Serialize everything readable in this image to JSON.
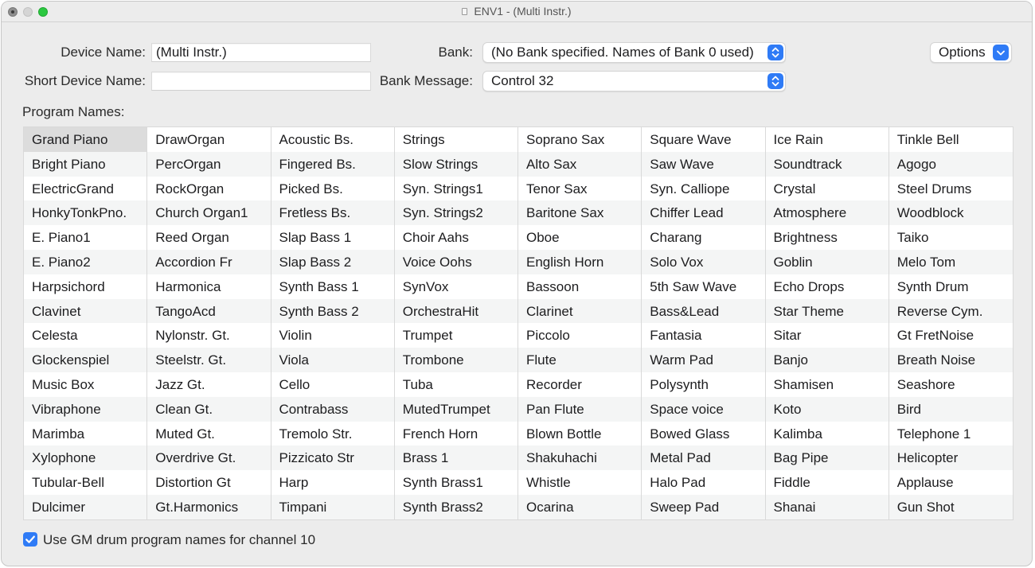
{
  "window": {
    "title": "ENV1 - (Multi Instr.)"
  },
  "form": {
    "device_name_label": "Device Name:",
    "device_name_value": "(Multi Instr.)",
    "short_device_name_label": "Short Device Name:",
    "short_device_name_value": "",
    "bank_label": "Bank:",
    "bank_value": "(No Bank specified. Names of Bank 0 used)",
    "bank_message_label": "Bank Message:",
    "bank_message_value": "Control 32",
    "options_label": "Options",
    "program_names_label": "Program Names:"
  },
  "program_columns": [
    [
      "Grand Piano",
      "Bright Piano",
      "ElectricGrand",
      "HonkyTonkPno.",
      "E. Piano1",
      "E. Piano2",
      "Harpsichord",
      "Clavinet",
      "Celesta",
      "Glockenspiel",
      "Music Box",
      "Vibraphone",
      "Marimba",
      "Xylophone",
      "Tubular-Bell",
      "Dulcimer"
    ],
    [
      "DrawOrgan",
      "PercOrgan",
      "RockOrgan",
      "Church Organ1",
      "Reed Organ",
      "Accordion Fr",
      "Harmonica",
      "TangoAcd",
      "Nylonstr. Gt.",
      "Steelstr. Gt.",
      "Jazz Gt.",
      "Clean Gt.",
      "Muted Gt.",
      "Overdrive Gt.",
      "Distortion Gt",
      "Gt.Harmonics"
    ],
    [
      "Acoustic Bs.",
      "Fingered Bs.",
      "Picked Bs.",
      "Fretless Bs.",
      "Slap Bass 1",
      "Slap Bass 2",
      "Synth Bass 1",
      "Synth Bass 2",
      "Violin",
      "Viola",
      "Cello",
      "Contrabass",
      "Tremolo Str.",
      "Pizzicato Str",
      "Harp",
      "Timpani"
    ],
    [
      "Strings",
      "Slow Strings",
      "Syn. Strings1",
      "Syn. Strings2",
      "Choir Aahs",
      "Voice Oohs",
      "SynVox",
      "OrchestraHit",
      "Trumpet",
      "Trombone",
      "Tuba",
      "MutedTrumpet",
      "French Horn",
      "Brass 1",
      "Synth Brass1",
      "Synth Brass2"
    ],
    [
      "Soprano Sax",
      "Alto Sax",
      "Tenor Sax",
      "Baritone Sax",
      "Oboe",
      "English Horn",
      "Bassoon",
      "Clarinet",
      "Piccolo",
      "Flute",
      "Recorder",
      "Pan Flute",
      "Blown Bottle",
      "Shakuhachi",
      "Whistle",
      "Ocarina"
    ],
    [
      "Square Wave",
      "Saw Wave",
      "Syn. Calliope",
      "Chiffer Lead",
      "Charang",
      "Solo Vox",
      "5th Saw Wave",
      "Bass&Lead",
      "Fantasia",
      "Warm Pad",
      "Polysynth",
      "Space voice",
      "Bowed Glass",
      "Metal Pad",
      "Halo Pad",
      "Sweep Pad"
    ],
    [
      "Ice Rain",
      "Soundtrack",
      "Crystal",
      "Atmosphere",
      "Brightness",
      "Goblin",
      "Echo Drops",
      "Star Theme",
      "Sitar",
      "Banjo",
      "Shamisen",
      "Koto",
      "Kalimba",
      "Bag Pipe",
      "Fiddle",
      "Shanai"
    ],
    [
      "Tinkle Bell",
      "Agogo",
      "Steel Drums",
      "Woodblock",
      "Taiko",
      "Melo Tom",
      "Synth Drum",
      "Reverse Cym.",
      "Gt FretNoise",
      "Breath Noise",
      "Seashore",
      "Bird",
      "Telephone 1",
      "Helicopter",
      "Applause",
      "Gun Shot"
    ]
  ],
  "selected_program": "Grand Piano",
  "checkbox": {
    "label": "Use GM drum program names for channel 10",
    "checked": true
  },
  "colors": {
    "accent": "#2f7bf6",
    "window_bg": "#ececec",
    "selected_row": "#dcdcdc"
  }
}
